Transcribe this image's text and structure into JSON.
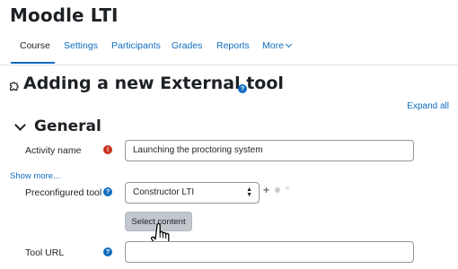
{
  "course": {
    "title": "Moodle LTI"
  },
  "tabs": [
    {
      "label": "Course"
    },
    {
      "label": "Settings"
    },
    {
      "label": "Participants"
    },
    {
      "label": "Grades"
    },
    {
      "label": "Reports"
    },
    {
      "label": "More"
    }
  ],
  "page": {
    "title": "Adding a new External tool",
    "expand_all": "Expand all"
  },
  "section": {
    "title": "General"
  },
  "form": {
    "activity_name_label": "Activity name",
    "activity_name_value": "Launching the proctoring system",
    "show_more": "Show more...",
    "preconfigured_tool_label": "Preconfigured tool",
    "preconfigured_tool_value": "Constructor LTI",
    "select_content_button": "Select content",
    "tool_url_label": "Tool URL",
    "tool_url_value": ""
  },
  "icons": {
    "help": "?",
    "required": "!",
    "add": "+",
    "remove": "×"
  },
  "colors": {
    "link": "#0f6cbf",
    "required": "#ca3120",
    "button_disabled": "#c2c7cd"
  }
}
